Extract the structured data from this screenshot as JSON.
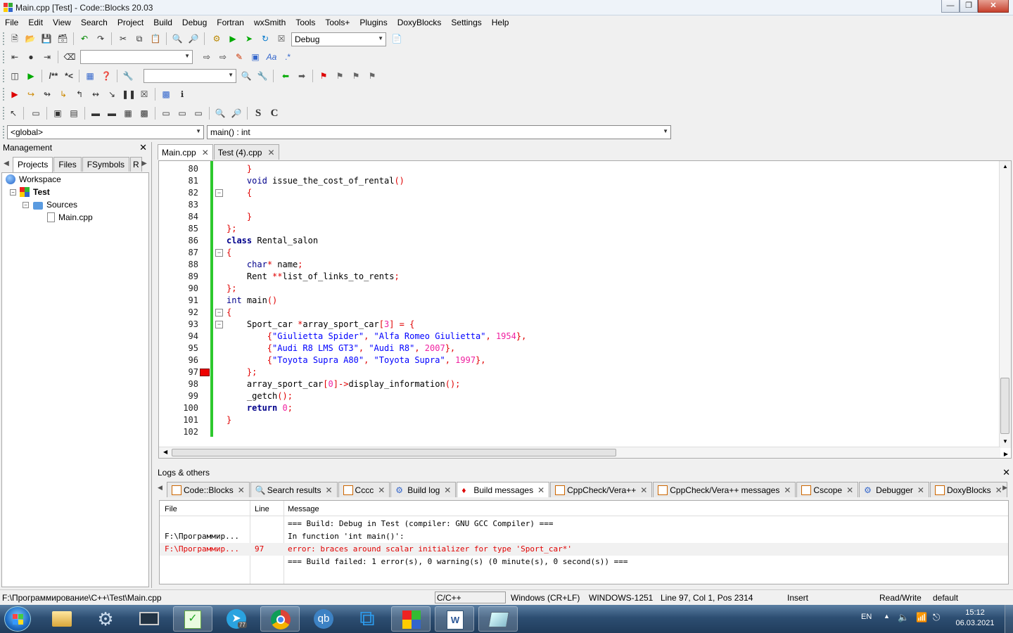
{
  "window": {
    "title": "Main.cpp [Test] - Code::Blocks 20.03"
  },
  "menu": [
    "File",
    "Edit",
    "View",
    "Search",
    "Project",
    "Build",
    "Debug",
    "Fortran",
    "wxSmith",
    "Tools",
    "Tools+",
    "Plugins",
    "DoxyBlocks",
    "Settings",
    "Help"
  ],
  "toolbar": {
    "build_target": "Debug",
    "scope": "<global>",
    "function": "main() : int",
    "bold_s": "S",
    "bold_c": "C",
    "comment1": "/**",
    "comment2": "*<",
    "regex": ".*"
  },
  "management": {
    "title": "Management",
    "tabs": [
      "Projects",
      "Files",
      "FSymbols",
      "R"
    ],
    "tree": {
      "workspace": "Workspace",
      "project": "Test",
      "folder": "Sources",
      "file": "Main.cpp"
    }
  },
  "editor": {
    "tabs": [
      {
        "label": "Main.cpp",
        "active": true
      },
      {
        "label": "Test (4).cpp",
        "active": false
      }
    ],
    "breakpoint_line": 97
  },
  "code": [
    {
      "n": "80",
      "segs": [
        [
          "    ",
          ""
        ],
        [
          "}",
          "op"
        ]
      ]
    },
    {
      "n": "81",
      "segs": [
        [
          "    ",
          ""
        ],
        [
          "void",
          "ty"
        ],
        [
          " issue_the_cost_of_rental",
          ""
        ],
        [
          "()",
          "op"
        ]
      ]
    },
    {
      "n": "82",
      "segs": [
        [
          "    ",
          ""
        ],
        [
          "{",
          "op"
        ]
      ]
    },
    {
      "n": "83",
      "segs": []
    },
    {
      "n": "84",
      "segs": [
        [
          "    ",
          ""
        ],
        [
          "}",
          "op"
        ]
      ]
    },
    {
      "n": "85",
      "segs": [
        [
          "};",
          "op"
        ]
      ]
    },
    {
      "n": "86",
      "segs": [
        [
          "class",
          "kw"
        ],
        [
          " Rental_salon",
          ""
        ]
      ]
    },
    {
      "n": "87",
      "segs": [
        [
          "{",
          "op"
        ]
      ]
    },
    {
      "n": "88",
      "segs": [
        [
          "    ",
          ""
        ],
        [
          "char",
          "ty"
        ],
        [
          "*",
          "op"
        ],
        [
          " name",
          ""
        ],
        [
          ";",
          "op"
        ]
      ]
    },
    {
      "n": "89",
      "segs": [
        [
          "    Rent ",
          ""
        ],
        [
          "**",
          "op"
        ],
        [
          "list_of_links_to_rents",
          ""
        ],
        [
          ";",
          "op"
        ]
      ]
    },
    {
      "n": "90",
      "segs": [
        [
          "};",
          "op"
        ]
      ]
    },
    {
      "n": "91",
      "segs": [
        [
          "int",
          "ty"
        ],
        [
          " main",
          ""
        ],
        [
          "()",
          "op"
        ]
      ]
    },
    {
      "n": "92",
      "segs": [
        [
          "{",
          "op"
        ]
      ]
    },
    {
      "n": "93",
      "segs": [
        [
          "    Sport_car ",
          ""
        ],
        [
          "*",
          "op"
        ],
        [
          "array_sport_car",
          ""
        ],
        [
          "[",
          "op"
        ],
        [
          "3",
          "nm"
        ],
        [
          "] = {",
          "op"
        ]
      ]
    },
    {
      "n": "94",
      "segs": [
        [
          "        ",
          ""
        ],
        [
          "{",
          "op"
        ],
        [
          "\"Giulietta Spider\"",
          "st"
        ],
        [
          ", ",
          "op"
        ],
        [
          "\"Alfa Romeo Giulietta\"",
          "st"
        ],
        [
          ", ",
          "op"
        ],
        [
          "1954",
          "nm"
        ],
        [
          "},",
          "op"
        ]
      ]
    },
    {
      "n": "95",
      "segs": [
        [
          "        ",
          ""
        ],
        [
          "{",
          "op"
        ],
        [
          "\"Audi R8 LMS GT3\"",
          "st"
        ],
        [
          ", ",
          "op"
        ],
        [
          "\"Audi R8\"",
          "st"
        ],
        [
          ", ",
          "op"
        ],
        [
          "2007",
          "nm"
        ],
        [
          "},",
          "op"
        ]
      ]
    },
    {
      "n": "96",
      "segs": [
        [
          "        ",
          ""
        ],
        [
          "{",
          "op"
        ],
        [
          "\"Toyota Supra A80\"",
          "st"
        ],
        [
          ", ",
          "op"
        ],
        [
          "\"Toyota Supra\"",
          "st"
        ],
        [
          ", ",
          "op"
        ],
        [
          "1997",
          "nm"
        ],
        [
          "},",
          "op"
        ]
      ]
    },
    {
      "n": "97",
      "segs": [
        [
          "    ",
          ""
        ],
        [
          "};",
          "op"
        ]
      ]
    },
    {
      "n": "98",
      "segs": [
        [
          "    array_sport_car",
          ""
        ],
        [
          "[",
          "op"
        ],
        [
          "0",
          "nm"
        ],
        [
          "]->",
          "op"
        ],
        [
          "display_information",
          ""
        ],
        [
          "();",
          "op"
        ]
      ]
    },
    {
      "n": "99",
      "segs": [
        [
          "    _getch",
          ""
        ],
        [
          "();",
          "op"
        ]
      ]
    },
    {
      "n": "100",
      "segs": [
        [
          "    ",
          ""
        ],
        [
          "return",
          "kw"
        ],
        [
          " ",
          ""
        ],
        [
          "0",
          "nm"
        ],
        [
          ";",
          "op"
        ]
      ]
    },
    {
      "n": "101",
      "segs": [
        [
          "}",
          "op"
        ]
      ]
    },
    {
      "n": "102",
      "segs": []
    }
  ],
  "logs": {
    "title": "Logs & others",
    "tabs": [
      {
        "label": "Code::Blocks",
        "active": false
      },
      {
        "label": "Search results",
        "active": false
      },
      {
        "label": "Cccc",
        "active": false
      },
      {
        "label": "Build log",
        "active": false
      },
      {
        "label": "Build messages",
        "active": true
      },
      {
        "label": "CppCheck/Vera++",
        "active": false
      },
      {
        "label": "CppCheck/Vera++ messages",
        "active": false
      },
      {
        "label": "Cscope",
        "active": false
      },
      {
        "label": "Debugger",
        "active": false
      },
      {
        "label": "DoxyBlocks",
        "active": false
      }
    ],
    "columns": [
      "File",
      "Line",
      "Message"
    ],
    "rows": [
      {
        "file": "",
        "line": "",
        "message": "=== Build: Debug in Test (compiler: GNU GCC Compiler) ===",
        "error": false
      },
      {
        "file": "F:\\Программир...",
        "line": "",
        "message": "In function 'int main()':",
        "error": false
      },
      {
        "file": "F:\\Программир...",
        "line": "97",
        "message": "error: braces around scalar initializer for type 'Sport_car*'",
        "error": true
      },
      {
        "file": "",
        "line": "",
        "message": "=== Build failed: 1 error(s), 0 warning(s) (0 minute(s), 0 second(s)) ===",
        "error": false
      }
    ]
  },
  "status": {
    "path": "F:\\Программирование\\C++\\Test\\Main.cpp",
    "lang": "C/C++",
    "eol": "Windows (CR+LF)",
    "encoding": "WINDOWS-1251",
    "position": "Line 97, Col 1, Pos 2314",
    "mode": "Insert",
    "access": "Read/Write",
    "profile": "default"
  },
  "taskbar": {
    "lang": "EN",
    "time": "15:12",
    "date": "06.03.2021",
    "telegram_badge": "77",
    "apps": [
      "start-orb",
      "explorer",
      "settings",
      "remote-desktop",
      "notepad-plus-plus",
      "telegram",
      "chrome",
      "qbittorrent",
      "vscode",
      "codeblocks",
      "word",
      "editor"
    ]
  }
}
